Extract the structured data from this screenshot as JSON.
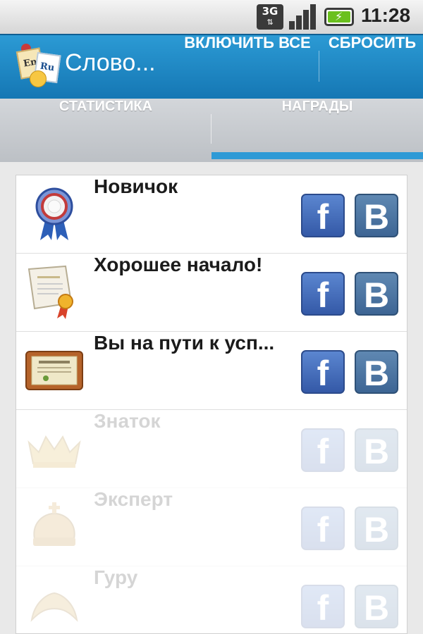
{
  "status_bar": {
    "network": "3G",
    "network_arrows": "⇅",
    "time": "11:28",
    "battery_color": "#6ac01e"
  },
  "action_bar": {
    "app_title": "Слово...",
    "app_icon_letters": [
      "En",
      "Ru"
    ],
    "enable_all_label": "ВКЛЮЧИТЬ ВСЕ",
    "reset_label": "СБРОСИТЬ",
    "background": "#1e88c6"
  },
  "tabs": [
    {
      "label": "СТАТИСТИКА",
      "selected": false
    },
    {
      "label": "НАГРАДЫ",
      "selected": true
    }
  ],
  "accent_color": "#2e9ad6",
  "awards": [
    {
      "name": "Новичок",
      "icon": "rosette-medal-icon",
      "unlocked": true,
      "share": [
        "f",
        "B"
      ]
    },
    {
      "name": "Хорошее начало!",
      "icon": "certificate-scroll-icon",
      "unlocked": true,
      "share": [
        "f",
        "B"
      ]
    },
    {
      "name": "Вы на пути к усп...",
      "icon": "framed-diploma-icon",
      "unlocked": true,
      "share": [
        "f",
        "B"
      ]
    },
    {
      "name": "Знаток",
      "icon": "crown-icon",
      "unlocked": false,
      "share": [
        "f",
        "B"
      ]
    },
    {
      "name": "Эксперт",
      "icon": "royal-crown-icon",
      "unlocked": false,
      "share": [
        "f",
        "B"
      ]
    },
    {
      "name": "Гуру",
      "icon": "laurel-wreath-icon",
      "unlocked": false,
      "share": [
        "f",
        "B"
      ]
    }
  ]
}
